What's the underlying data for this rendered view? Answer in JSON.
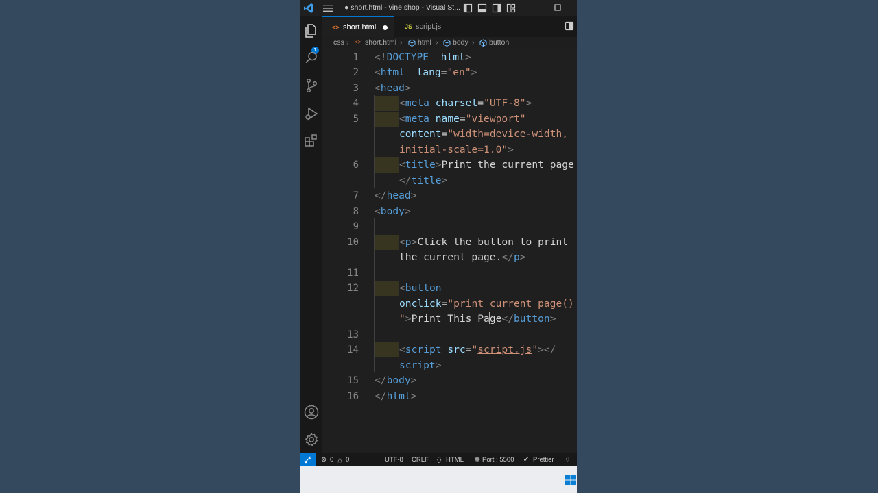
{
  "titlebar": {
    "title": "● short.html - vine shop - Visual St..."
  },
  "activity": {
    "badge": "1",
    "items": [
      "explorer-icon",
      "search-icon",
      "source-control-icon",
      "run-debug-icon",
      "extensions-icon",
      "account-icon",
      "settings-gear-icon"
    ]
  },
  "tabs": [
    {
      "icon": "<>",
      "label": "short.html",
      "modified": true
    },
    {
      "icon": "JS",
      "label": "script.js",
      "modified": false
    }
  ],
  "breadcrumb": [
    "css",
    "short.html",
    "html",
    "body",
    "button"
  ],
  "editor": {
    "line_numbers": [
      "1",
      "2",
      "3",
      "4",
      "5",
      "6",
      "7",
      "8",
      "9",
      "10",
      "11",
      "12",
      "13",
      "14",
      "15",
      "16"
    ],
    "lines": [
      {
        "num": "1",
        "tokens": [
          [
            "g",
            "<!"
          ],
          [
            "t",
            "DOCTYPE"
          ],
          [
            "",
            "  "
          ],
          [
            "a",
            "html"
          ],
          [
            "g",
            ">"
          ]
        ]
      },
      {
        "num": "2",
        "tokens": [
          [
            "g",
            "<"
          ],
          [
            "t",
            "html"
          ],
          [
            "",
            "  "
          ],
          [
            "a",
            "lang"
          ],
          [
            "",
            "="
          ],
          [
            "s",
            "\"en\""
          ],
          [
            "g",
            ">"
          ]
        ]
      },
      {
        "num": "3",
        "tokens": [
          [
            "g",
            "<"
          ],
          [
            "t",
            "head"
          ],
          [
            "g",
            ">"
          ]
        ]
      },
      {
        "num": "4",
        "tokens": [
          [
            "g",
            "<"
          ],
          [
            "t",
            "meta"
          ],
          [
            "",
            " "
          ],
          [
            "a",
            "charset"
          ],
          [
            "",
            "="
          ],
          [
            "s",
            "\"UTF-8\""
          ],
          [
            "g",
            ">"
          ]
        ]
      },
      {
        "num": "5",
        "tokens": [
          [
            "g",
            "<"
          ],
          [
            "t",
            "meta"
          ],
          [
            "",
            " "
          ],
          [
            "a",
            "name"
          ],
          [
            "",
            "="
          ],
          [
            "s",
            "\"viewport\""
          ]
        ]
      },
      {
        "num": "",
        "tokens": [
          [
            "a",
            "content"
          ],
          [
            "",
            "="
          ],
          [
            "s",
            "\"width=device-width,"
          ]
        ]
      },
      {
        "num": "",
        "tokens": [
          [
            "s",
            "initial-scale=1.0\""
          ],
          [
            "g",
            ">"
          ]
        ]
      },
      {
        "num": "6",
        "tokens": [
          [
            "g",
            "<"
          ],
          [
            "t",
            "title"
          ],
          [
            "g",
            ">"
          ],
          [
            "",
            "Print the current page"
          ]
        ]
      },
      {
        "num": "",
        "tokens": [
          [
            "g",
            "</"
          ],
          [
            "t",
            "title"
          ],
          [
            "g",
            ">"
          ]
        ]
      },
      {
        "num": "7",
        "tokens": [
          [
            "g",
            "</"
          ],
          [
            "t",
            "head"
          ],
          [
            "g",
            ">"
          ]
        ]
      },
      {
        "num": "8",
        "tokens": [
          [
            "g",
            "<"
          ],
          [
            "t",
            "body"
          ],
          [
            "g",
            ">"
          ]
        ]
      },
      {
        "num": "9",
        "tokens": []
      },
      {
        "num": "10",
        "tokens": [
          [
            "g",
            "<"
          ],
          [
            "t",
            "p"
          ],
          [
            "g",
            ">"
          ],
          [
            "",
            "Click the button to print"
          ]
        ]
      },
      {
        "num": "",
        "tokens": [
          [
            "",
            "the current page."
          ],
          [
            "g",
            "</"
          ],
          [
            "t",
            "p"
          ],
          [
            "g",
            ">"
          ]
        ]
      },
      {
        "num": "11",
        "tokens": []
      },
      {
        "num": "12",
        "tokens": [
          [
            "g",
            "<"
          ],
          [
            "t",
            "button"
          ]
        ]
      },
      {
        "num": "",
        "tokens": [
          [
            "a",
            "onclick"
          ],
          [
            "",
            "="
          ],
          [
            "s",
            "\"print_current_page()"
          ]
        ]
      },
      {
        "num": "",
        "tokens": [
          [
            "s",
            "\""
          ],
          [
            "g",
            ">"
          ],
          [
            "",
            "Print This Pa"
          ],
          [
            "cursor",
            ""
          ],
          [
            "",
            "ge"
          ],
          [
            "g",
            "</"
          ],
          [
            "t",
            "button"
          ],
          [
            "g",
            ">"
          ]
        ]
      },
      {
        "num": "13",
        "tokens": []
      },
      {
        "num": "14",
        "tokens": [
          [
            "g",
            "<"
          ],
          [
            "t",
            "script"
          ],
          [
            "",
            " "
          ],
          [
            "a",
            "src"
          ],
          [
            "",
            "="
          ],
          [
            "s",
            "\""
          ],
          [
            "su",
            "script.js"
          ],
          [
            "s",
            "\""
          ],
          [
            "g",
            "></"
          ]
        ]
      },
      {
        "num": "",
        "tokens": [
          [
            "t",
            "script"
          ],
          [
            "g",
            ">"
          ]
        ]
      },
      {
        "num": "15",
        "tokens": [
          [
            "g",
            "</"
          ],
          [
            "t",
            "body"
          ],
          [
            "g",
            ">"
          ]
        ]
      },
      {
        "num": "16",
        "tokens": [
          [
            "g",
            "</"
          ],
          [
            "t",
            "html"
          ],
          [
            "g",
            ">"
          ]
        ]
      }
    ]
  },
  "status": {
    "problems": "0",
    "warnings": "0",
    "encoding": "UTF-8",
    "eol": "CRLF",
    "language": "HTML",
    "port": "Port : 5500",
    "prettier": "Prettier"
  },
  "colors": {
    "accent": "#0078d4",
    "tag": "#569cd6",
    "attribute": "#9cdcfe",
    "string": "#ce9178",
    "bracket": "#808080"
  }
}
